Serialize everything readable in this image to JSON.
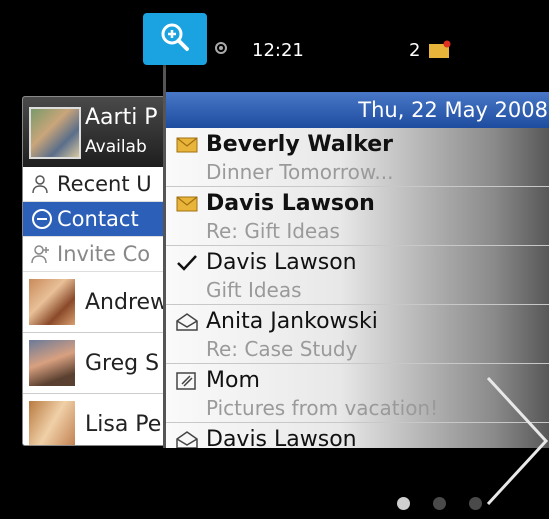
{
  "colors": {
    "zoom_button": "#1aa3e0",
    "date_bar": "#2b5fb8",
    "selected_row": "#2b5fb8",
    "unread_envelope": "#e8b43a"
  },
  "zoom": {
    "icon": "zoom-in-icon"
  },
  "contacts_card": {
    "profile": {
      "name": "Aarti P",
      "status": "Availab"
    },
    "menu": [
      {
        "label": "Recent U",
        "icon": "person-icon",
        "selected": false
      },
      {
        "label": "Contact",
        "icon": "minus-circle-icon",
        "selected": true
      },
      {
        "label": "Invite Co",
        "icon": "person-add-icon",
        "selected": false
      }
    ],
    "contacts": [
      {
        "name": "Andrew"
      },
      {
        "name": "Greg S"
      },
      {
        "name": "Lisa Pe"
      }
    ]
  },
  "messages_card": {
    "status": {
      "time": "12:21",
      "notification_count": "2"
    },
    "date": "Thu, 22 May 2008",
    "messages": [
      {
        "sender": "Beverly Walker",
        "subject": "Dinner Tomorrow...",
        "icon": "unread-envelope-icon",
        "unread": true
      },
      {
        "sender": "Davis Lawson",
        "subject": "Re: Gift Ideas",
        "icon": "unread-envelope-icon",
        "unread": true
      },
      {
        "sender": "Davis Lawson",
        "subject": "Gift Ideas",
        "icon": "sent-check-icon",
        "unread": false
      },
      {
        "sender": "Anita Jankowski",
        "subject": "Re: Case Study",
        "icon": "opened-envelope-icon",
        "unread": false
      },
      {
        "sender": "Mom",
        "subject": "Pictures from vacation!",
        "icon": "attachment-envelope-icon",
        "unread": false
      },
      {
        "sender": "Davis Lawson",
        "subject": "",
        "icon": "opened-envelope-icon",
        "unread": false
      }
    ]
  },
  "pager": {
    "pages": 3,
    "current": 1
  },
  "navigation": {
    "next_icon": "chevron-right-icon"
  }
}
